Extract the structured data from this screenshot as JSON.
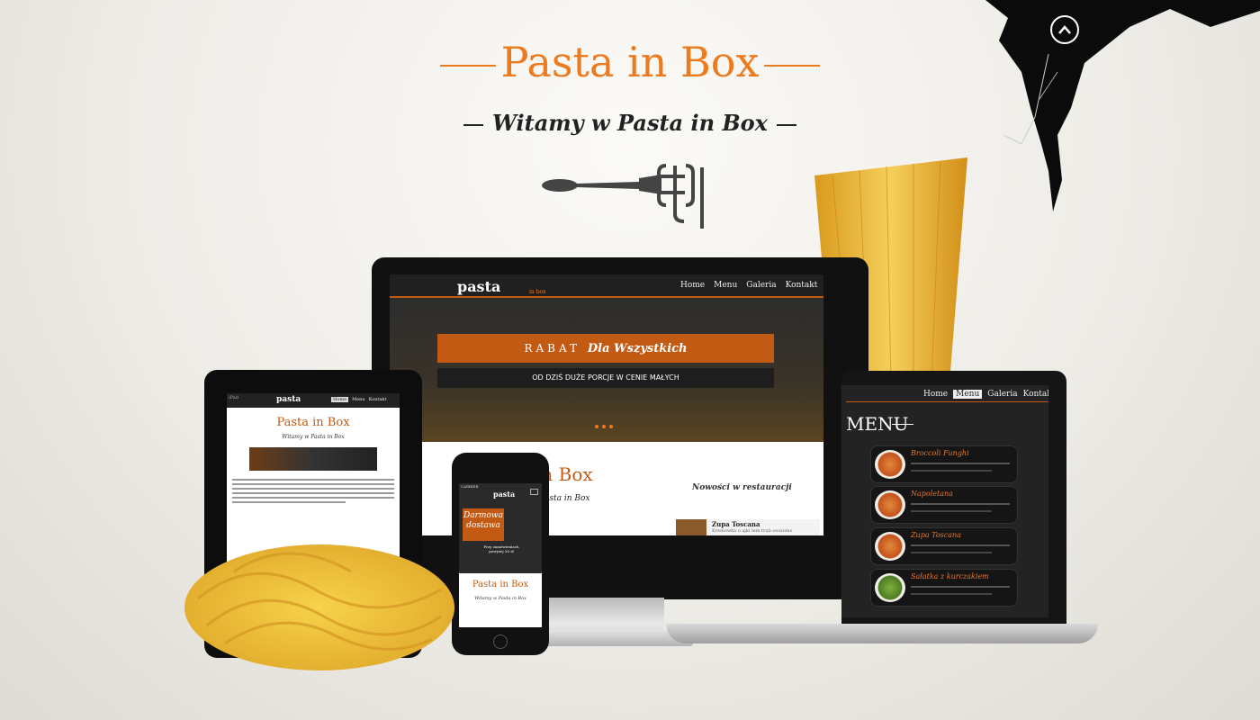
{
  "hero": {
    "title": "Pasta in Box",
    "subtitle": "Witamy w Pasta in Box"
  },
  "colors": {
    "accent": "#ec7a1e",
    "dark_band": "#c35a13",
    "screen_bg": "#1a1a1a"
  },
  "icons": {
    "up": "chevron-up-icon",
    "logo": "fork-pasta-icon"
  },
  "desktop": {
    "logo_text": "pasta",
    "logo_sub": "in box",
    "nav": [
      "Home",
      "Menu",
      "Galeria",
      "Kontakt"
    ],
    "banner_prefix": "RABAT",
    "banner_script": "Dla Wszystkich",
    "banner_sub": "OD DZIŚ DUŻE PORCJE W CENIE MAŁYCH",
    "section_title": "in Box",
    "section_sub": "asta in Box",
    "news_title": "Nowości w restauracji",
    "news_item": "Zupa Toscana",
    "news_item_desc": "Kremówka o ajki lem trub osusoms"
  },
  "laptop": {
    "nav": [
      "Home",
      "Menu",
      "Galeria",
      "Kontakt"
    ],
    "menu_title": "MENU",
    "items": [
      {
        "name": "Broccoli Funghi",
        "desc": "Cena : 600g : 6,00 PLN"
      },
      {
        "name": "Napoletana",
        "desc": "Cena : 600g : 6,00 PLN"
      },
      {
        "name": "Zupa Toscana",
        "desc": "Cena : 400 ml : 6,00 PLN"
      },
      {
        "name": "Sałatka z kurczakiem",
        "desc": "Cena : 400 ml : 6,00 PLN"
      }
    ]
  },
  "tablet": {
    "carrier": "iPad",
    "logo_text": "pasta",
    "nav": [
      "Home",
      "Menu",
      "Kontakt"
    ],
    "title": "Pasta in Box",
    "subtitle": "Witamy w Pasta in Box"
  },
  "phone": {
    "carrier": "CARRIER",
    "logo_text": "pasta",
    "promo_title": "Darmowa dostawa",
    "promo_sub": "Przy zamówieniach powyżej 30 zł",
    "title": "Pasta in Box",
    "subtitle": "Witamy w Pasta in Box"
  }
}
